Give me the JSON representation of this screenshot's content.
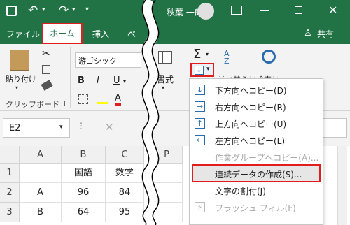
{
  "title_bar": {
    "user_name": "秋葉 一郎",
    "undo_icon": "undo-icon",
    "redo_icon": "redo-icon"
  },
  "tabs": {
    "file": "ファイル",
    "home": "ホーム",
    "insert": "挿入",
    "page": "ペ",
    "share": "共有"
  },
  "ribbon": {
    "paste_label": "貼り付け",
    "clipboard_group": "クリップボード",
    "font_name": "游ゴシック",
    "bold": "B",
    "italic": "I",
    "underline": "U",
    "format_label": "書式",
    "sort_label": "並べ替えと",
    "find_label": "検索と",
    "autosum": "Σ"
  },
  "formula_bar": {
    "name_box": "E2"
  },
  "grid": {
    "columns": [
      "A",
      "B",
      "C",
      "P"
    ],
    "rows": [
      "1",
      "2",
      "3"
    ],
    "cells": {
      "b1": "国語",
      "c1": "数学",
      "a2": "A",
      "b2": "96",
      "c2": "84",
      "a3": "B",
      "b3": "64",
      "c3": "95"
    }
  },
  "fill_menu": {
    "items": [
      {
        "label": "下方向へコピー(D)",
        "icon": "arrow-down-icon",
        "enabled": true
      },
      {
        "label": "右方向へコピー(R)",
        "icon": "arrow-right-icon",
        "enabled": true
      },
      {
        "label": "上方向へコピー(U)",
        "icon": "arrow-up-icon",
        "enabled": true
      },
      {
        "label": "左方向へコピー(L)",
        "icon": "arrow-left-icon",
        "enabled": true
      },
      {
        "label": "作業グループへコピー(A)...",
        "icon": "",
        "enabled": false
      },
      {
        "label": "連続データの作成(S)...",
        "icon": "",
        "enabled": true
      },
      {
        "label": "文字の割付(J)",
        "icon": "",
        "enabled": true
      },
      {
        "label": "フラッシュ フィル(F)",
        "icon": "flash-fill-icon",
        "enabled": false
      }
    ]
  },
  "colors": {
    "excel_green": "#217346",
    "highlight_red": "#e01e1e",
    "icon_blue": "#2b6cb0"
  }
}
